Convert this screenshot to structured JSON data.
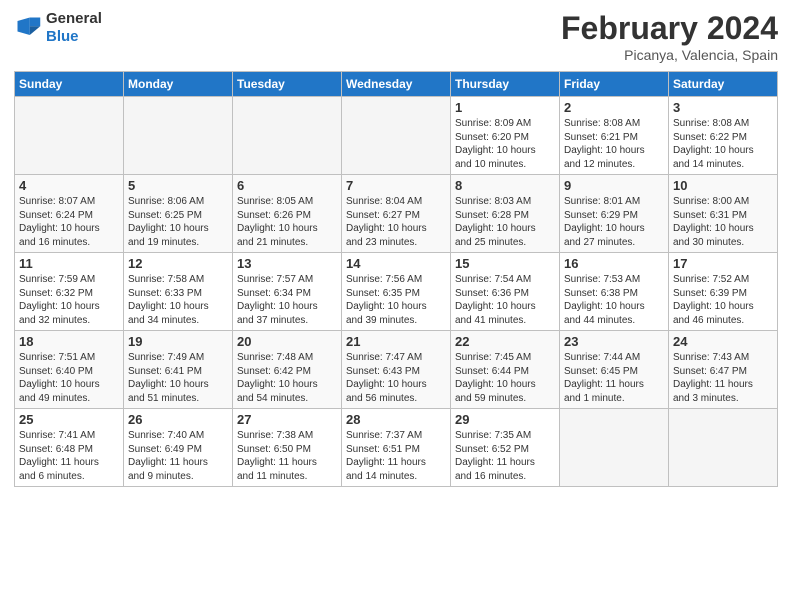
{
  "header": {
    "logo_line1": "General",
    "logo_line2": "Blue",
    "title": "February 2024",
    "subtitle": "Picanya, Valencia, Spain"
  },
  "days_of_week": [
    "Sunday",
    "Monday",
    "Tuesday",
    "Wednesday",
    "Thursday",
    "Friday",
    "Saturday"
  ],
  "weeks": [
    [
      {
        "num": "",
        "info": ""
      },
      {
        "num": "",
        "info": ""
      },
      {
        "num": "",
        "info": ""
      },
      {
        "num": "",
        "info": ""
      },
      {
        "num": "1",
        "info": "Sunrise: 8:09 AM\nSunset: 6:20 PM\nDaylight: 10 hours\nand 10 minutes."
      },
      {
        "num": "2",
        "info": "Sunrise: 8:08 AM\nSunset: 6:21 PM\nDaylight: 10 hours\nand 12 minutes."
      },
      {
        "num": "3",
        "info": "Sunrise: 8:08 AM\nSunset: 6:22 PM\nDaylight: 10 hours\nand 14 minutes."
      }
    ],
    [
      {
        "num": "4",
        "info": "Sunrise: 8:07 AM\nSunset: 6:24 PM\nDaylight: 10 hours\nand 16 minutes."
      },
      {
        "num": "5",
        "info": "Sunrise: 8:06 AM\nSunset: 6:25 PM\nDaylight: 10 hours\nand 19 minutes."
      },
      {
        "num": "6",
        "info": "Sunrise: 8:05 AM\nSunset: 6:26 PM\nDaylight: 10 hours\nand 21 minutes."
      },
      {
        "num": "7",
        "info": "Sunrise: 8:04 AM\nSunset: 6:27 PM\nDaylight: 10 hours\nand 23 minutes."
      },
      {
        "num": "8",
        "info": "Sunrise: 8:03 AM\nSunset: 6:28 PM\nDaylight: 10 hours\nand 25 minutes."
      },
      {
        "num": "9",
        "info": "Sunrise: 8:01 AM\nSunset: 6:29 PM\nDaylight: 10 hours\nand 27 minutes."
      },
      {
        "num": "10",
        "info": "Sunrise: 8:00 AM\nSunset: 6:31 PM\nDaylight: 10 hours\nand 30 minutes."
      }
    ],
    [
      {
        "num": "11",
        "info": "Sunrise: 7:59 AM\nSunset: 6:32 PM\nDaylight: 10 hours\nand 32 minutes."
      },
      {
        "num": "12",
        "info": "Sunrise: 7:58 AM\nSunset: 6:33 PM\nDaylight: 10 hours\nand 34 minutes."
      },
      {
        "num": "13",
        "info": "Sunrise: 7:57 AM\nSunset: 6:34 PM\nDaylight: 10 hours\nand 37 minutes."
      },
      {
        "num": "14",
        "info": "Sunrise: 7:56 AM\nSunset: 6:35 PM\nDaylight: 10 hours\nand 39 minutes."
      },
      {
        "num": "15",
        "info": "Sunrise: 7:54 AM\nSunset: 6:36 PM\nDaylight: 10 hours\nand 41 minutes."
      },
      {
        "num": "16",
        "info": "Sunrise: 7:53 AM\nSunset: 6:38 PM\nDaylight: 10 hours\nand 44 minutes."
      },
      {
        "num": "17",
        "info": "Sunrise: 7:52 AM\nSunset: 6:39 PM\nDaylight: 10 hours\nand 46 minutes."
      }
    ],
    [
      {
        "num": "18",
        "info": "Sunrise: 7:51 AM\nSunset: 6:40 PM\nDaylight: 10 hours\nand 49 minutes."
      },
      {
        "num": "19",
        "info": "Sunrise: 7:49 AM\nSunset: 6:41 PM\nDaylight: 10 hours\nand 51 minutes."
      },
      {
        "num": "20",
        "info": "Sunrise: 7:48 AM\nSunset: 6:42 PM\nDaylight: 10 hours\nand 54 minutes."
      },
      {
        "num": "21",
        "info": "Sunrise: 7:47 AM\nSunset: 6:43 PM\nDaylight: 10 hours\nand 56 minutes."
      },
      {
        "num": "22",
        "info": "Sunrise: 7:45 AM\nSunset: 6:44 PM\nDaylight: 10 hours\nand 59 minutes."
      },
      {
        "num": "23",
        "info": "Sunrise: 7:44 AM\nSunset: 6:45 PM\nDaylight: 11 hours\nand 1 minute."
      },
      {
        "num": "24",
        "info": "Sunrise: 7:43 AM\nSunset: 6:47 PM\nDaylight: 11 hours\nand 3 minutes."
      }
    ],
    [
      {
        "num": "25",
        "info": "Sunrise: 7:41 AM\nSunset: 6:48 PM\nDaylight: 11 hours\nand 6 minutes."
      },
      {
        "num": "26",
        "info": "Sunrise: 7:40 AM\nSunset: 6:49 PM\nDaylight: 11 hours\nand 9 minutes."
      },
      {
        "num": "27",
        "info": "Sunrise: 7:38 AM\nSunset: 6:50 PM\nDaylight: 11 hours\nand 11 minutes."
      },
      {
        "num": "28",
        "info": "Sunrise: 7:37 AM\nSunset: 6:51 PM\nDaylight: 11 hours\nand 14 minutes."
      },
      {
        "num": "29",
        "info": "Sunrise: 7:35 AM\nSunset: 6:52 PM\nDaylight: 11 hours\nand 16 minutes."
      },
      {
        "num": "",
        "info": ""
      },
      {
        "num": "",
        "info": ""
      }
    ]
  ]
}
